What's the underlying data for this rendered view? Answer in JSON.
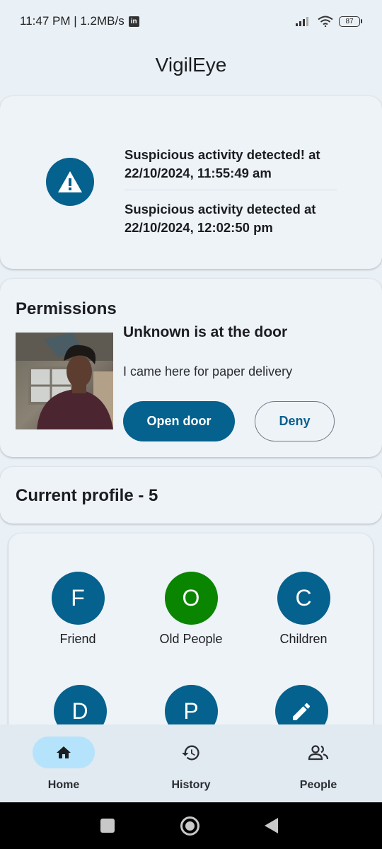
{
  "status_bar": {
    "time_speed": "11:47 PM | 1.2MB/s",
    "linkedin_badge": "in",
    "battery": "87"
  },
  "app": {
    "title": "VigilEye"
  },
  "alerts": {
    "icon": "warning-icon",
    "items": [
      "Suspicious activity detected! at 22/10/2024, 11:55:49 am",
      "Suspicious activity detected at 22/10/2024, 12:02:50 pm"
    ]
  },
  "permissions": {
    "title": "Permissions",
    "visitor_name": "Unknown is at the door",
    "message": "I came here for paper delivery",
    "open_label": "Open door",
    "deny_label": "Deny"
  },
  "profile": {
    "heading": "Current profile - 5",
    "items": [
      {
        "letter": "F",
        "label": "Friend",
        "color": "#05618d"
      },
      {
        "letter": "O",
        "label": "Old People",
        "color": "#0a8500"
      },
      {
        "letter": "C",
        "label": "Children",
        "color": "#05618d"
      },
      {
        "letter": "D",
        "label": "",
        "color": "#05618d"
      },
      {
        "letter": "P",
        "label": "",
        "color": "#05618d"
      },
      {
        "icon": "edit-pencil-icon",
        "label": "",
        "color": "#05618d"
      }
    ]
  },
  "bottom_nav": {
    "items": [
      {
        "label": "Home",
        "icon": "home-icon",
        "active": true
      },
      {
        "label": "History",
        "icon": "history-icon",
        "active": false
      },
      {
        "label": "People",
        "icon": "people-icon",
        "active": false
      }
    ]
  },
  "colors": {
    "primary": "#05618d",
    "old_people_green": "#0a8500",
    "nav_active_pill": "#b5e3fb",
    "background": "#e9f0f6"
  }
}
